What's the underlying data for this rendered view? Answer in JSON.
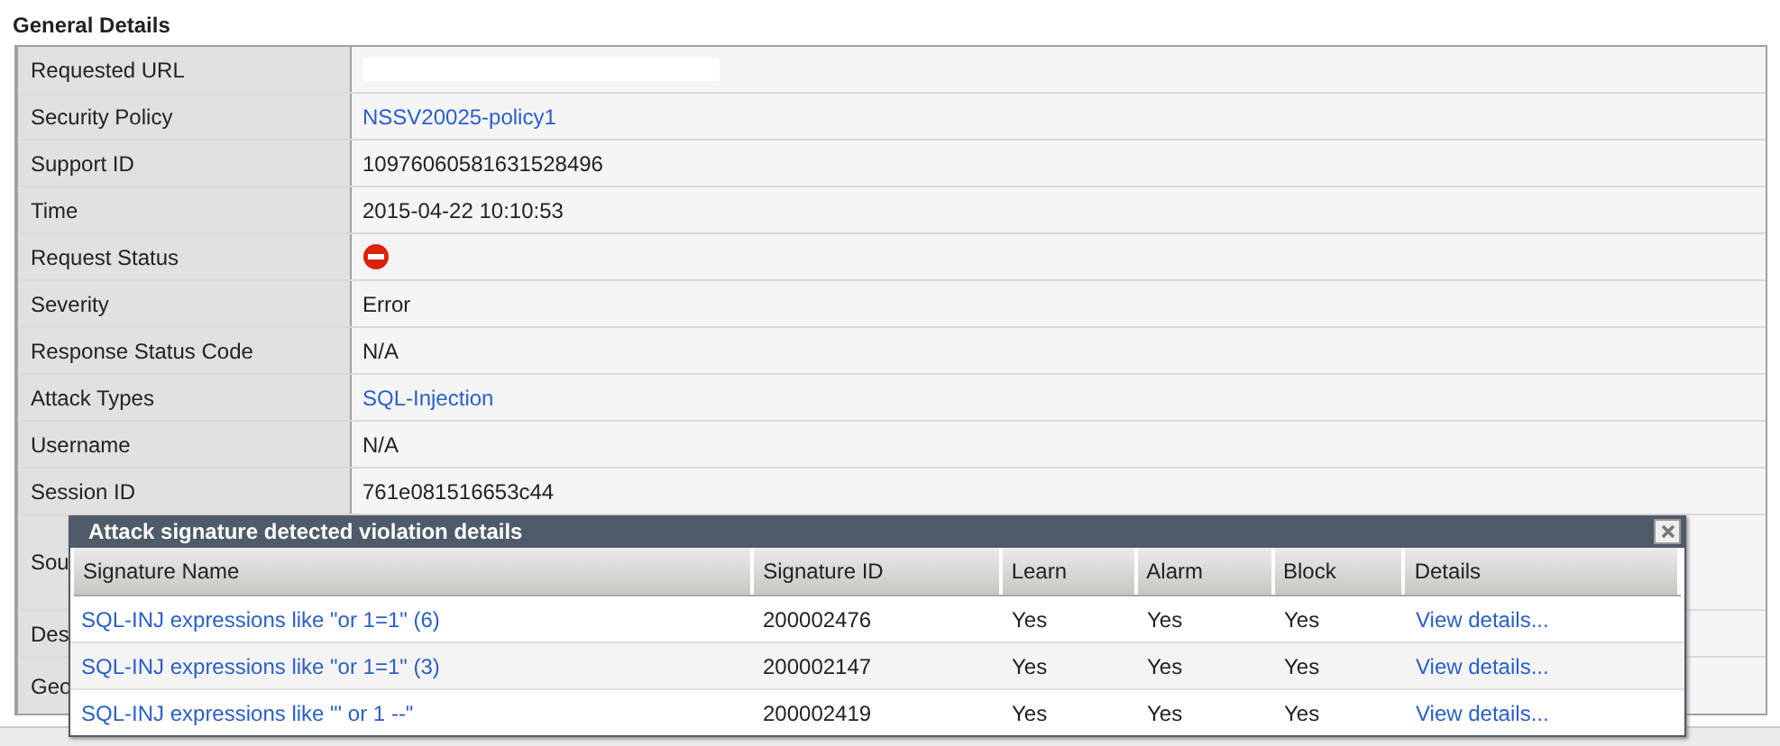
{
  "section_title": "General Details",
  "details": [
    {
      "label": "Requested URL",
      "kind": "redacted"
    },
    {
      "label": "Security Policy",
      "kind": "link",
      "value": "NSSV20025-policy1"
    },
    {
      "label": "Support ID",
      "kind": "text",
      "value": "10976060581631528496"
    },
    {
      "label": "Time",
      "kind": "text",
      "value": "2015-04-22 10:10:53"
    },
    {
      "label": "Request Status",
      "kind": "status",
      "blocked": true
    },
    {
      "label": "Severity",
      "kind": "text",
      "value": "Error"
    },
    {
      "label": "Response Status Code",
      "kind": "text",
      "value": "N/A"
    },
    {
      "label": "Attack Types",
      "kind": "link",
      "value": "SQL-Injection"
    },
    {
      "label": "Username",
      "kind": "text",
      "value": "N/A"
    },
    {
      "label": "Session ID",
      "kind": "text",
      "value": "761e081516653c44"
    },
    {
      "label": "Sou",
      "kind": "hidden",
      "tall": true
    },
    {
      "label": "Des",
      "kind": "hidden"
    },
    {
      "label": "Geo",
      "kind": "hidden"
    }
  ],
  "dialog": {
    "title": "Attack signature detected violation details",
    "columns": [
      "Signature Name",
      "Signature ID",
      "Learn",
      "Alarm",
      "Block",
      "Details"
    ],
    "rows": [
      {
        "signature_name": "SQL-INJ expressions like \"or 1=1\" (6)",
        "signature_id": "200002476",
        "learn": "Yes",
        "alarm": "Yes",
        "block": "Yes",
        "details": "View details..."
      },
      {
        "signature_name": "SQL-INJ expressions like \"or 1=1\" (3)",
        "signature_id": "200002147",
        "learn": "Yes",
        "alarm": "Yes",
        "block": "Yes",
        "details": "View details..."
      },
      {
        "signature_name": "SQL-INJ expressions like \"' or 1 --\"",
        "signature_id": "200002419",
        "learn": "Yes",
        "alarm": "Yes",
        "block": "Yes",
        "details": "View details..."
      }
    ]
  }
}
